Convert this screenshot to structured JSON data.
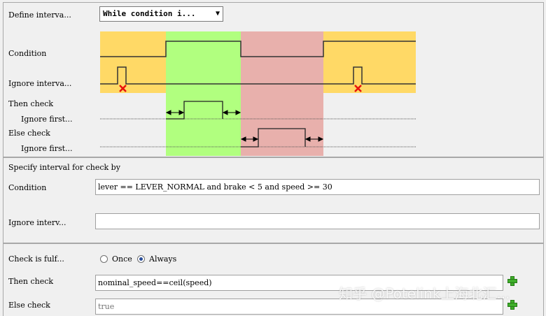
{
  "diagram": {
    "define_interval_label": "Define interva...",
    "define_interval_value": "While condition i...",
    "condition_label": "Condition",
    "ignore_interval_label": "Ignore interva...",
    "then_check_label": "Then check",
    "then_ignore_first_label": "Ignore first...",
    "else_check_label": "Else check",
    "else_ignore_first_label": "Ignore first...",
    "colors": {
      "yellow": "#ffd966",
      "green": "#b1ff7f",
      "red": "#e8b0ac",
      "cross": "#e8120c"
    }
  },
  "interval": {
    "section_title": "Specify interval for check by",
    "condition_label": "Condition",
    "condition_value": "lever == LEVER_NORMAL and brake < 5 and speed >= 30",
    "ignore_interval_label": "Ignore interv...",
    "ignore_interval_value": ""
  },
  "checks": {
    "fulfilled_label": "Check is fulf...",
    "once_label": "Once",
    "always_label": "Always",
    "selected": "Always",
    "then_check_label": "Then check",
    "then_check_value": "nominal_speed==ceil(speed)",
    "else_check_label": "Else check",
    "else_check_placeholder": "true"
  },
  "watermark": "知乎 @Potelink上海北汇..."
}
